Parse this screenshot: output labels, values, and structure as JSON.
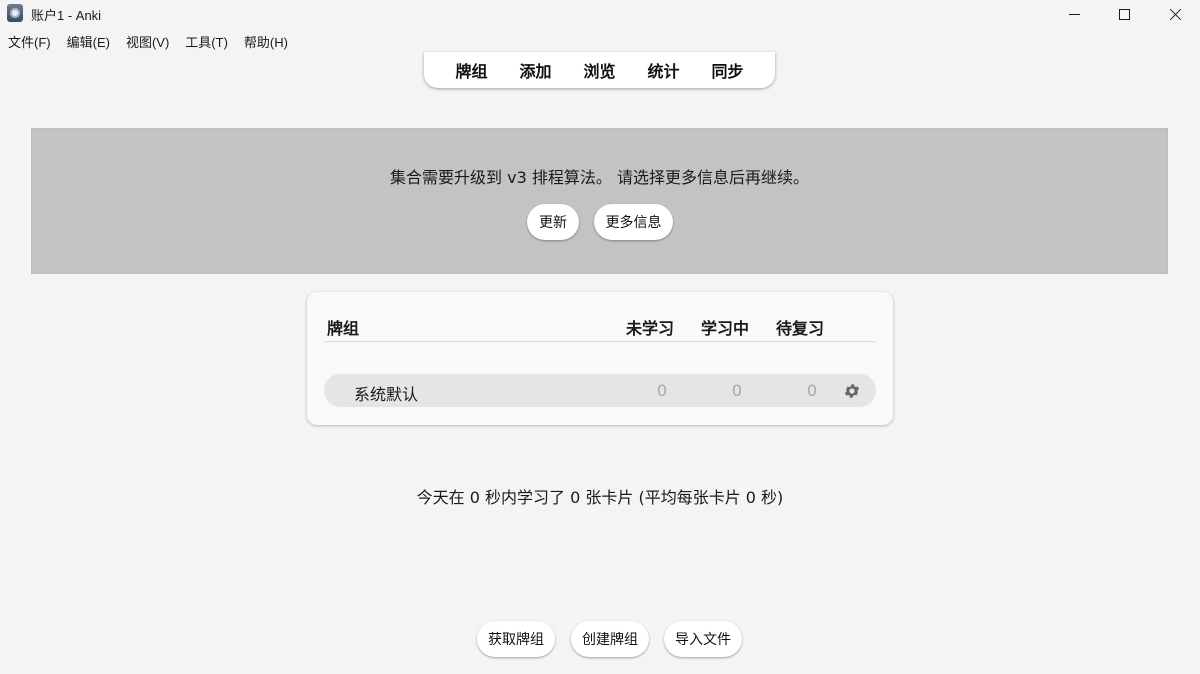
{
  "window": {
    "title": "账户1 - Anki",
    "controls": {
      "minimize_icon": "minimize-icon",
      "maximize_icon": "maximize-icon",
      "close_icon": "close-icon"
    }
  },
  "menubar": {
    "items": [
      "文件(F)",
      "编辑(E)",
      "视图(V)",
      "工具(T)",
      "帮助(H)"
    ]
  },
  "topnav": {
    "links": [
      "牌组",
      "添加",
      "浏览",
      "统计",
      "同步"
    ]
  },
  "banner": {
    "message": "集合需要升级到 v3 排程算法。 请选择更多信息后再继续。",
    "update_label": "更新",
    "more_info_label": "更多信息",
    "background": "#c3c3c3"
  },
  "deck_table": {
    "headers": {
      "deck": "牌组",
      "new": "未学习",
      "learning": "学习中",
      "due": "待复习"
    },
    "rows": [
      {
        "name": "系统默认",
        "new": "0",
        "learning": "0",
        "due": "0",
        "options_icon": "gear-icon"
      }
    ]
  },
  "stats": {
    "text": "今天在 0 秒内学习了 0 张卡片 (平均每张卡片 0 秒)"
  },
  "footer": {
    "get_shared_label": "获取牌组",
    "create_deck_label": "创建牌组",
    "import_file_label": "导入文件"
  }
}
